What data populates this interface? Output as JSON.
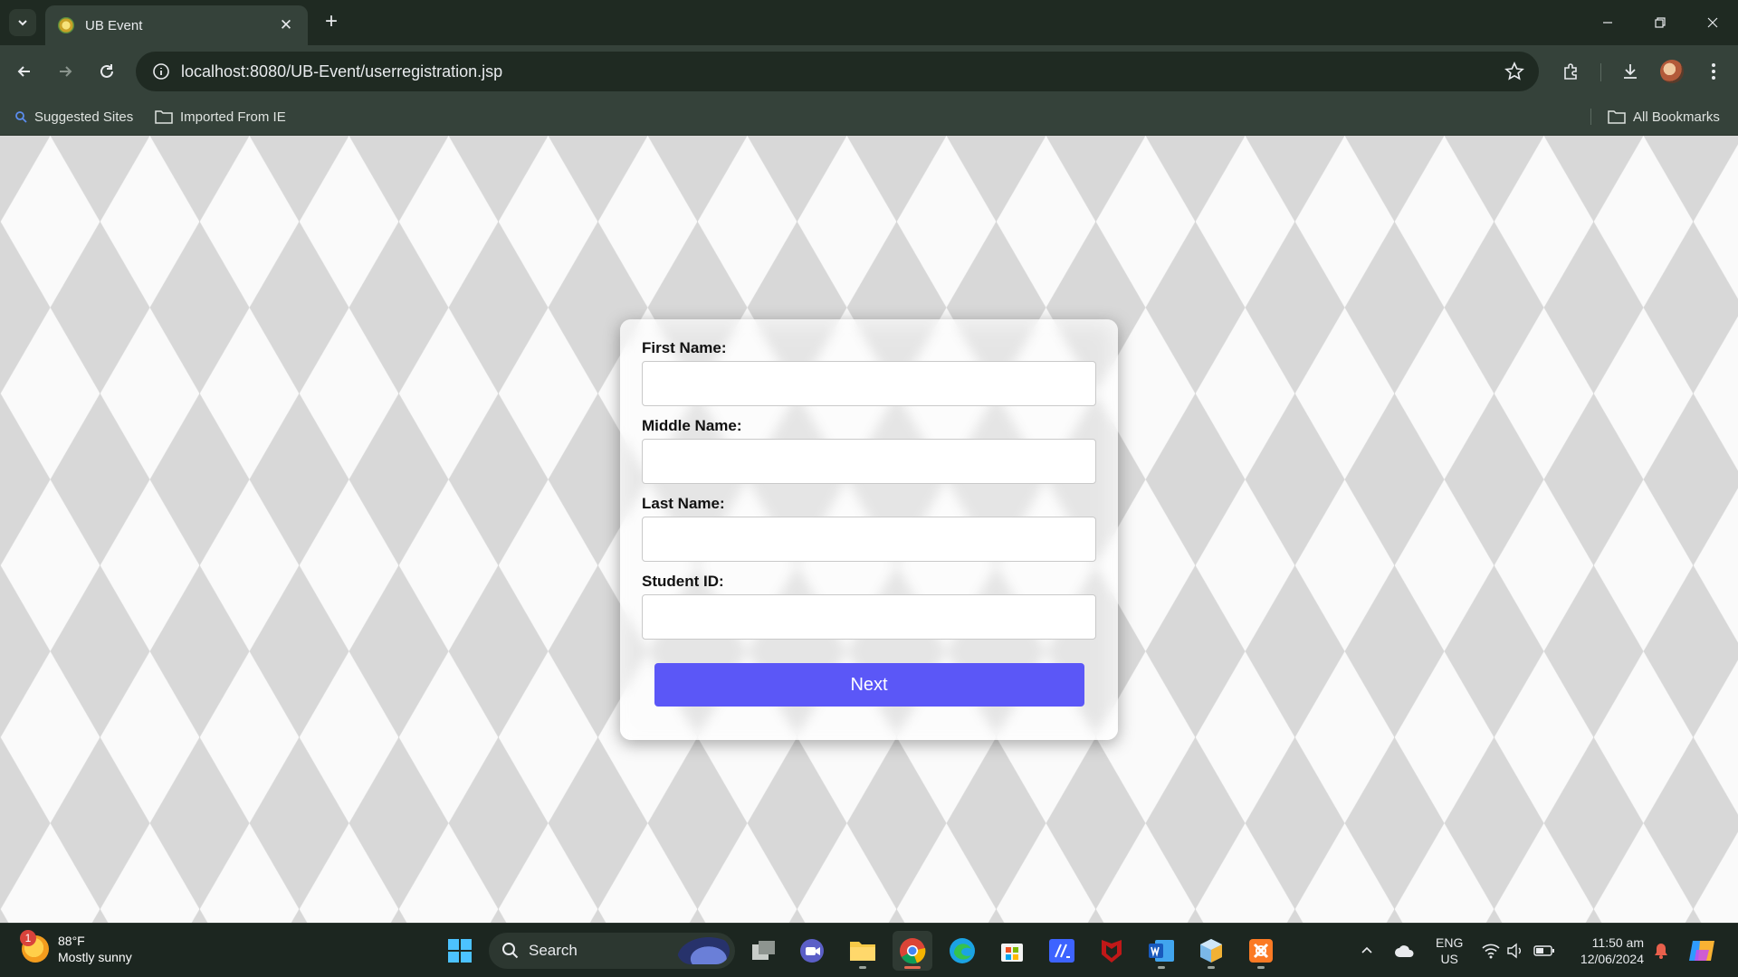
{
  "browser": {
    "tab_title": "UB Event",
    "url": "localhost:8080/UB-Event/userregistration.jsp",
    "bookmarks": [
      {
        "label": "Suggested Sites",
        "icon": "search-icon"
      },
      {
        "label": "Imported From IE",
        "icon": "folder-icon"
      }
    ],
    "all_bookmarks_label": "All Bookmarks"
  },
  "form": {
    "fields": [
      {
        "label": "First Name:",
        "value": ""
      },
      {
        "label": "Middle Name:",
        "value": ""
      },
      {
        "label": "Last Name:",
        "value": ""
      },
      {
        "label": "Student ID:",
        "value": ""
      }
    ],
    "submit_label": "Next",
    "accent_color": "#5b57f7"
  },
  "taskbar": {
    "weather_temp": "88°F",
    "weather_desc": "Mostly sunny",
    "weather_badge": "1",
    "search_label": "Search",
    "lang_top": "ENG",
    "lang_bottom": "US",
    "time": "11:50 am",
    "date": "12/06/2024"
  }
}
